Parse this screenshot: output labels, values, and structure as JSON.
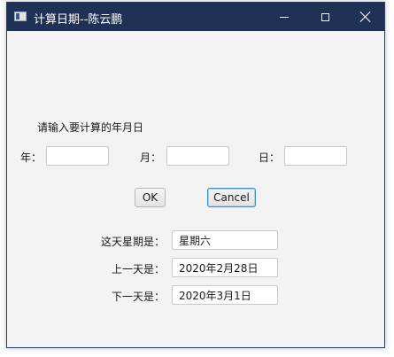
{
  "window": {
    "title": "计算日期--陈云鹏",
    "icon": "app-window-icon"
  },
  "form": {
    "prompt": "请输入要计算的年月日",
    "year_label": "年：",
    "month_label": "月：",
    "day_label": "日：",
    "year_value": "",
    "month_value": "",
    "day_value": ""
  },
  "buttons": {
    "ok_label": "OK",
    "cancel_label": "Cancel"
  },
  "results": {
    "weekday_label": "这天星期是：",
    "weekday_value": "星期六",
    "prev_label": "上一天是：",
    "prev_value": "2020年2月28日",
    "next_label": "下一天是：",
    "next_value": "2020年3月1日"
  },
  "colors": {
    "titlebar": "#1f3256",
    "window_bg": "#f3f3f4",
    "focus_border": "#3c8fd8"
  }
}
